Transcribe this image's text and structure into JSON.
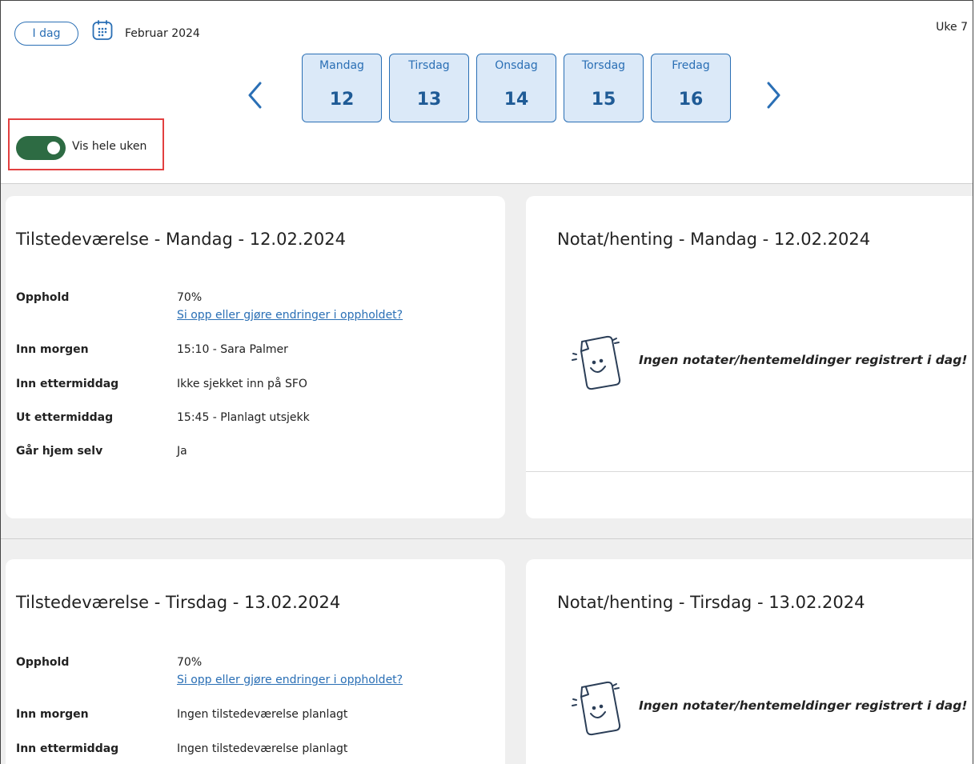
{
  "header": {
    "today_label": "I dag",
    "month_label": "Februar 2024",
    "week_label": "Uke 7"
  },
  "days": [
    {
      "name": "Mandag",
      "number": "12"
    },
    {
      "name": "Tirsdag",
      "number": "13"
    },
    {
      "name": "Onsdag",
      "number": "14"
    },
    {
      "name": "Torsdag",
      "number": "15"
    },
    {
      "name": "Fredag",
      "number": "16"
    }
  ],
  "toggle": {
    "label": "Vis hele uken",
    "on": true,
    "color": "#2d6b43"
  },
  "highlight_color": "#e24040",
  "accent_color": "#2a6fb5",
  "sections": [
    {
      "attendance": {
        "title": "Tilstedeværelse - Mandag - 12.02.2024",
        "rows": [
          {
            "label": "Opphold",
            "value": "70%",
            "link": "Si opp eller gjøre endringer i oppholdet?"
          },
          {
            "label": "Inn morgen",
            "value": "15:10 - Sara Palmer"
          },
          {
            "label": "Inn ettermiddag",
            "value": "Ikke sjekket inn på SFO"
          },
          {
            "label": "Ut ettermiddag",
            "value": "15:45 - Planlagt utsjekk"
          },
          {
            "label": "Går hjem selv",
            "value": "Ja"
          }
        ]
      },
      "notes": {
        "title": "Notat/henting - Mandag - 12.02.2024",
        "empty_message": "Ingen notater/hentemeldinger registrert i dag!",
        "icon": "smiley-note-icon"
      }
    },
    {
      "attendance": {
        "title": "Tilstedeværelse - Tirsdag - 13.02.2024",
        "rows": [
          {
            "label": "Opphold",
            "value": "70%",
            "link": "Si opp eller gjøre endringer i oppholdet?"
          },
          {
            "label": "Inn morgen",
            "value": "Ingen tilstedeværelse planlagt"
          },
          {
            "label": "Inn ettermiddag",
            "value": "Ingen tilstedeværelse planlagt"
          }
        ]
      },
      "notes": {
        "title": "Notat/henting - Tirsdag - 13.02.2024",
        "empty_message": "Ingen notater/hentemeldinger registrert i dag!",
        "icon": "smiley-note-icon"
      }
    }
  ]
}
